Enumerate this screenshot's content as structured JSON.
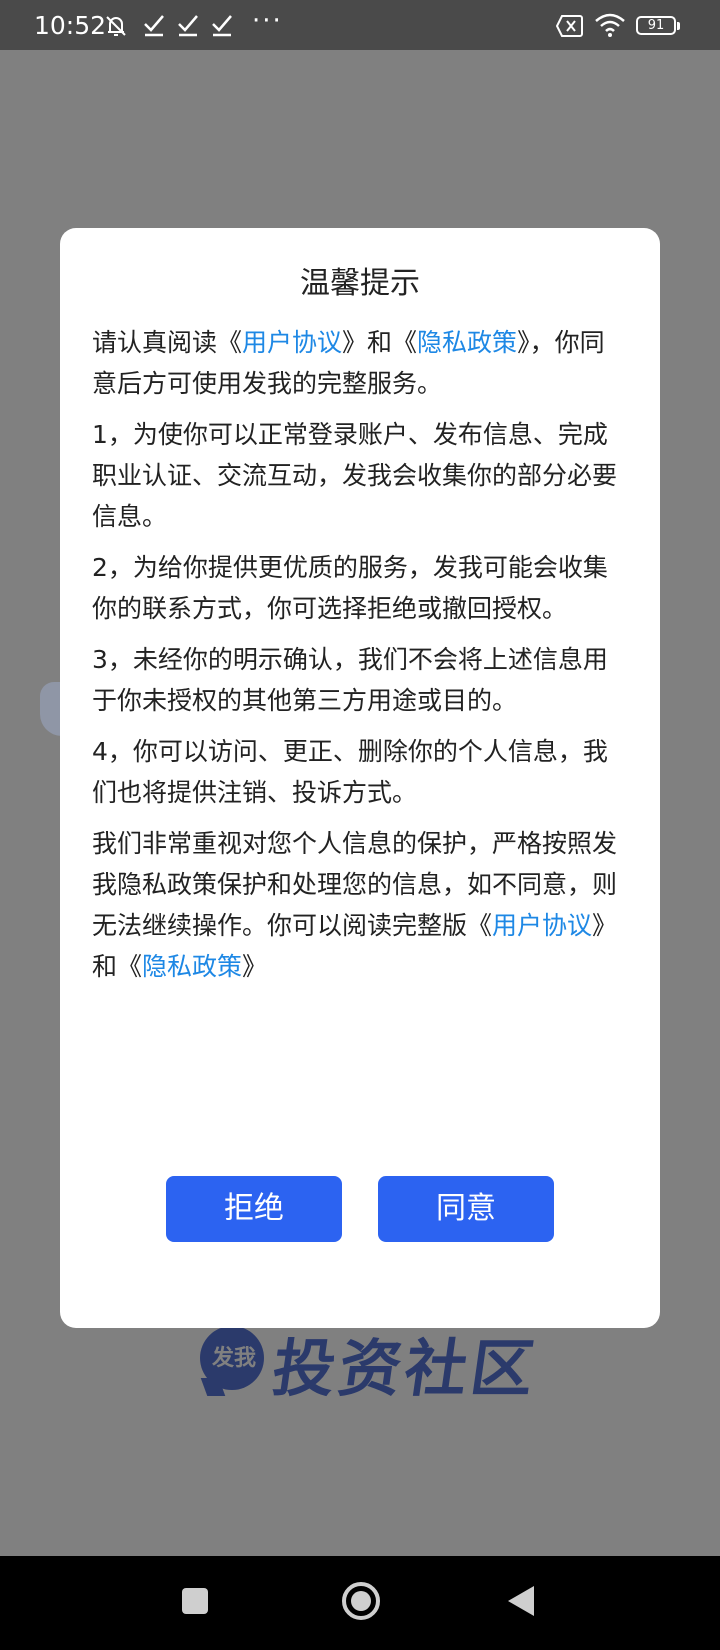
{
  "status_bar": {
    "time": "10:52",
    "overflow": "···",
    "battery_level": "91",
    "icons": [
      "bell-muted-icon",
      "check-icon",
      "check-icon",
      "check-icon",
      "sim-x-icon",
      "wifi-icon",
      "battery-icon"
    ]
  },
  "dialog": {
    "title": "温馨提示",
    "intro": {
      "prefix": "请认真阅读《",
      "link1": "用户协议",
      "middle": "》和《",
      "link2": "隐私政策",
      "suffix": "》，你同意后方可使用发我的完整服务。"
    },
    "items": [
      "1，为使你可以正常登录账户、发布信息、完成职业认证、交流互动，发我会收集你的部分必要信息。",
      "2，为给你提供更优质的服务，发我可能会收集你的联系方式，你可选择拒绝或撤回授权。",
      "3，未经你的明示确认，我们不会将上述信息用于你未授权的其他第三方用途或目的。",
      "4，你可以访问、更正、删除你的个人信息，我们也将提供注销、投诉方式。"
    ],
    "closing": {
      "text": "我们非常重视对您个人信息的保护，严格按照发我隐私政策保护和处理您的信息，如不同意，则无法继续操作。你可以阅读完整版《",
      "link1": "用户协议",
      "middle": "》和《",
      "link2": "隐私政策",
      "suffix": "》"
    },
    "reject_label": "拒绝",
    "agree_label": "同意"
  },
  "background": {
    "brand_badge": "发我",
    "brand_title": "投资社区"
  },
  "colors": {
    "link": "#1e88e5",
    "button": "#2c63f1",
    "overlay": "#808080",
    "brand": "#2b3a6b"
  }
}
